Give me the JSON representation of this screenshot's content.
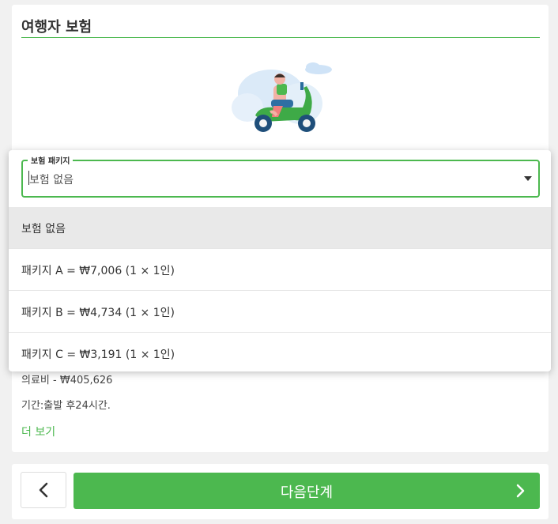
{
  "section": {
    "title": "여행자 보험",
    "info_medical": "의료비 - ₩405,626",
    "info_period": "기간:출발 후24시간.",
    "more_link": "더 보기"
  },
  "dropdown": {
    "label": "보험 패키지",
    "value": "보험 없음",
    "options": [
      {
        "label": "보험 없음",
        "selected": true
      },
      {
        "label": "패키지 A = ₩7,006 (1 × 1인)",
        "selected": false
      },
      {
        "label": "패키지 B = ₩4,734 (1 × 1인)",
        "selected": false
      },
      {
        "label": "패키지 C = ₩3,191 (1 × 1인)",
        "selected": false
      }
    ]
  },
  "footer": {
    "next_label": "다음단계",
    "back_icon": "chevron-left-icon",
    "next_icon": "chevron-right-icon"
  },
  "colors": {
    "accent": "#4cb84f",
    "selected_option_bg": "#e9e9e9",
    "page_bg": "#f1f1f1"
  }
}
